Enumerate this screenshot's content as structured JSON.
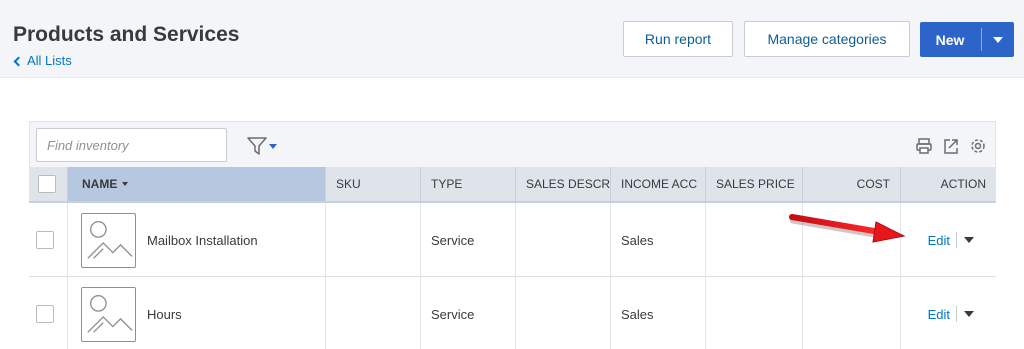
{
  "header": {
    "title": "Products and Services",
    "back_link": "All Lists",
    "buttons": {
      "run_report": "Run report",
      "manage_categories": "Manage categories",
      "new": "New"
    }
  },
  "toolbar": {
    "search_placeholder": "Find inventory",
    "icons": [
      "filter-icon",
      "print-icon",
      "export-icon",
      "settings-icon"
    ]
  },
  "table": {
    "columns": [
      "NAME",
      "SKU",
      "TYPE",
      "SALES DESCR",
      "INCOME ACC",
      "SALES PRICE",
      "COST",
      "ACTION"
    ],
    "sorted_column": "NAME",
    "rows": [
      {
        "name": "Mailbox Installation",
        "sku": "",
        "type": "Service",
        "sales_desc": "",
        "income_account": "Sales",
        "sales_price": "",
        "cost": "",
        "action": "Edit"
      },
      {
        "name": "Hours",
        "sku": "",
        "type": "Service",
        "sales_desc": "",
        "income_account": "Sales",
        "sales_price": "",
        "cost": "",
        "action": "Edit"
      }
    ]
  },
  "colors": {
    "accent_blue": "#0077c5",
    "primary_button": "#2d64c9",
    "header_bg": "#f4f5f8",
    "table_header_bg": "#dfe3ea",
    "sorted_header_bg": "#b5c8e0",
    "annotation_arrow": "#e8151b"
  }
}
